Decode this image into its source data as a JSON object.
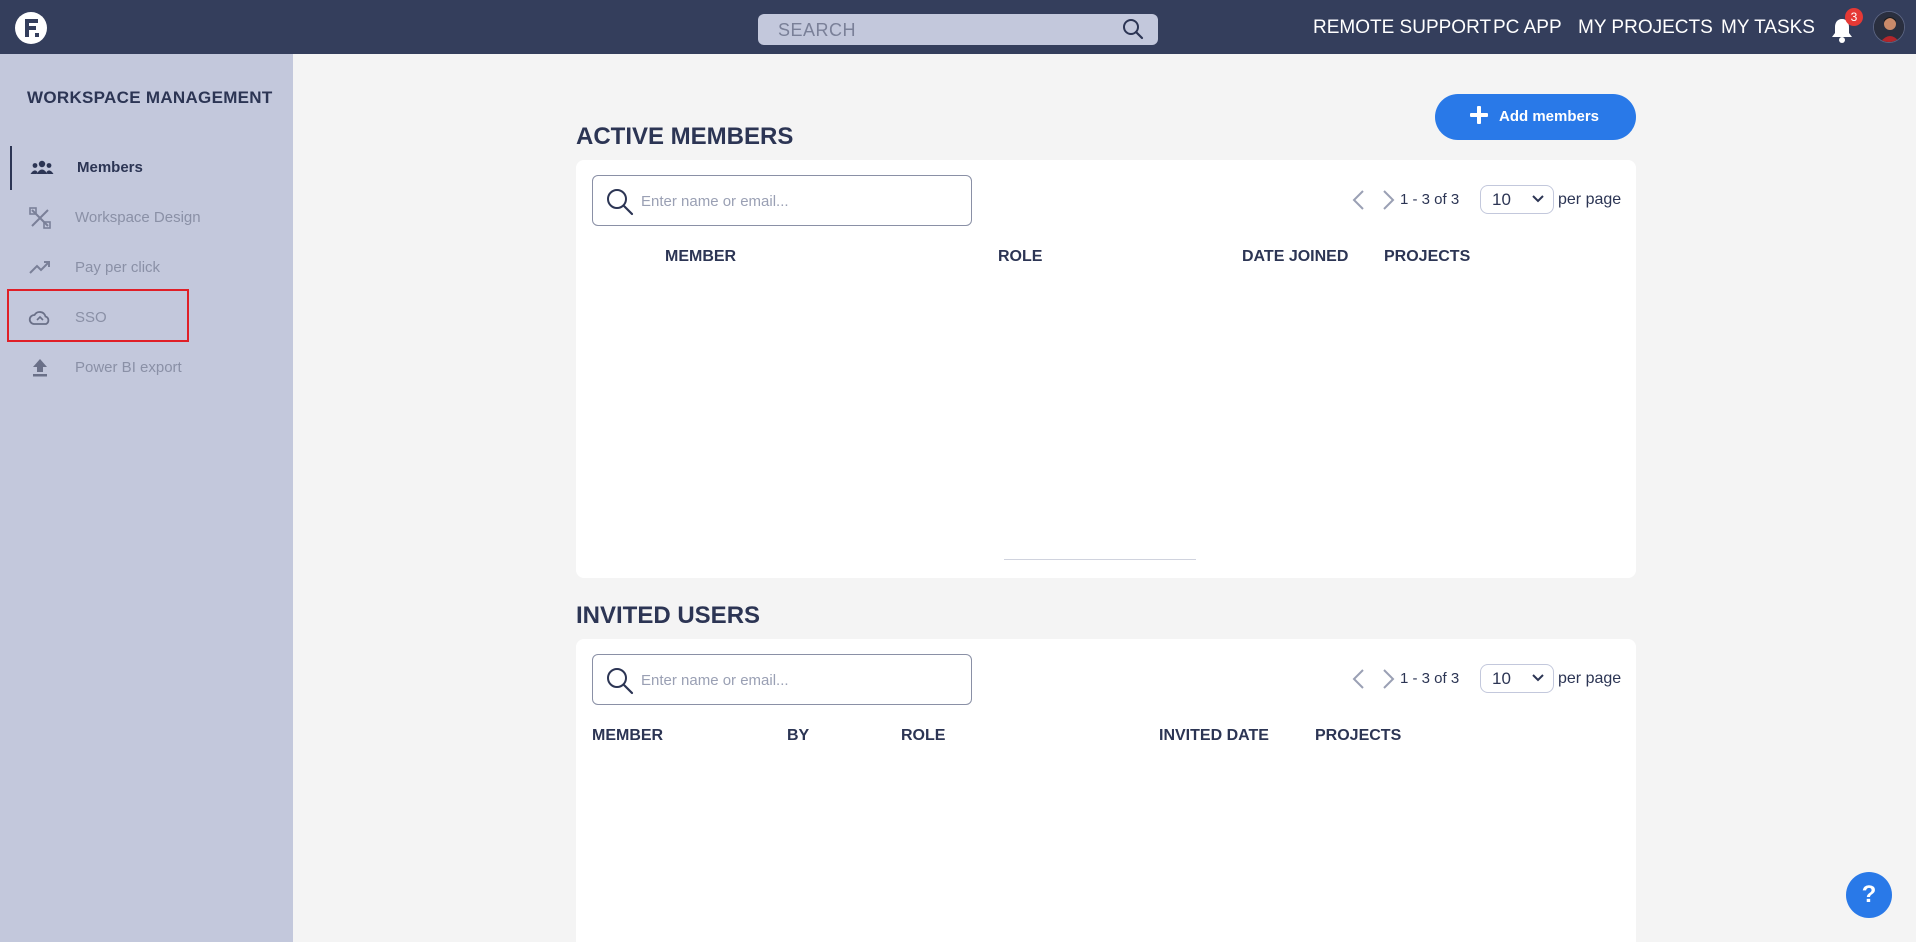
{
  "topbar": {
    "search_placeholder": "SEARCH",
    "nav": [
      "REMOTE SUPPORT",
      "PC APP",
      "MY PROJECTS",
      "MY TASKS"
    ],
    "notification_count": "3"
  },
  "sidebar": {
    "title": "WORKSPACE MANAGEMENT",
    "items": [
      {
        "label": "Members",
        "icon": "members-icon"
      },
      {
        "label": "Workspace Design",
        "icon": "design-tools-icon"
      },
      {
        "label": "Pay per click",
        "icon": "trending-up-icon"
      },
      {
        "label": "SSO",
        "icon": "cloud-icon"
      },
      {
        "label": "Power BI export",
        "icon": "upload-icon"
      }
    ]
  },
  "active_members": {
    "title": "ACTIVE MEMBERS",
    "add_button": "Add members",
    "search_placeholder": "Enter name or email...",
    "pagination": "1 - 3 of 3",
    "per_page_value": "10",
    "per_page_label": "per page",
    "columns": [
      "MEMBER",
      "ROLE",
      "DATE JOINED",
      "PROJECTS"
    ]
  },
  "invited_users": {
    "title": "INVITED USERS",
    "search_placeholder": "Enter name or email...",
    "pagination": "1 - 3 of 3",
    "per_page_value": "10",
    "per_page_label": "per page",
    "columns": [
      "MEMBER",
      "BY",
      "ROLE",
      "INVITED DATE",
      "PROJECTS"
    ]
  },
  "help": {
    "label": "?"
  },
  "colors": {
    "topbar": "#343e5c",
    "sidebar": "#c3c8dc",
    "accent": "#2979e8",
    "highlight": "#e01f27"
  }
}
